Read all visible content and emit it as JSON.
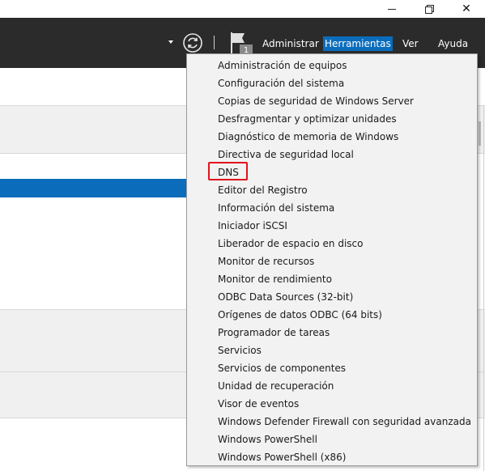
{
  "window_controls": {
    "minimize": "—",
    "close": "✕"
  },
  "menubar": {
    "notification_count": "1",
    "items": [
      {
        "label": "Administrar"
      },
      {
        "label": "Herramientas",
        "active": true
      },
      {
        "label": "Ver"
      },
      {
        "label": "Ayuda"
      }
    ],
    "active_color": "#0a6cbb",
    "background_color": "#2b2b2b"
  },
  "tools_menu": {
    "items": [
      {
        "label": "Administración de equipos"
      },
      {
        "label": "Configuración del sistema"
      },
      {
        "label": "Copias de seguridad de Windows Server"
      },
      {
        "label": "Desfragmentar y optimizar unidades"
      },
      {
        "label": "Diagnóstico de memoria de Windows"
      },
      {
        "label": "Directiva de seguridad local"
      },
      {
        "label": "DNS",
        "highlighted": true
      },
      {
        "label": "Editor del Registro"
      },
      {
        "label": "Información del sistema"
      },
      {
        "label": "Iniciador iSCSI"
      },
      {
        "label": "Liberador de espacio en disco"
      },
      {
        "label": "Monitor de recursos"
      },
      {
        "label": "Monitor de rendimiento"
      },
      {
        "label": "ODBC Data Sources (32-bit)"
      },
      {
        "label": "Orígenes de datos ODBC (64 bits)"
      },
      {
        "label": "Programador de tareas"
      },
      {
        "label": "Servicios"
      },
      {
        "label": "Servicios de componentes"
      },
      {
        "label": "Unidad de recuperación"
      },
      {
        "label": "Visor de eventos"
      },
      {
        "label": "Windows Defender Firewall con seguridad avanzada"
      },
      {
        "label": "Windows PowerShell"
      },
      {
        "label": "Windows PowerShell (x86)"
      }
    ],
    "highlight_color": "#e0141e"
  },
  "icons": {
    "refresh": "refresh-icon",
    "flag": "notification-flag-icon",
    "caret": "dropdown-caret-icon"
  }
}
